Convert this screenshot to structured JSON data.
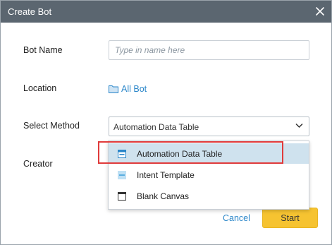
{
  "dialog": {
    "title": "Create Bot",
    "close_icon": "close-icon"
  },
  "form": {
    "bot_name": {
      "label": "Bot Name",
      "value": "",
      "placeholder": "Type in name here"
    },
    "location": {
      "label": "Location",
      "value": "All Bot",
      "icon": "folder-icon"
    },
    "select_method": {
      "label": "Select Method",
      "value": "Automation Data Table",
      "icon": "chevron-down-icon"
    },
    "creator": {
      "label": "Creator"
    }
  },
  "dropdown": {
    "options": [
      {
        "label": "Automation Data Table",
        "icon": "data-table-icon",
        "selected": true
      },
      {
        "label": "Intent Template",
        "icon": "intent-template-icon",
        "selected": false
      },
      {
        "label": "Blank Canvas",
        "icon": "blank-canvas-icon",
        "selected": false
      }
    ]
  },
  "footer": {
    "cancel_label": "Cancel",
    "start_label": "Start"
  },
  "colors": {
    "titlebar": "#5b6670",
    "link": "#2a86c9",
    "primary_button": "#f6c331",
    "selected_option": "#cfe2ee",
    "annotation_box": "#e03b3b"
  }
}
